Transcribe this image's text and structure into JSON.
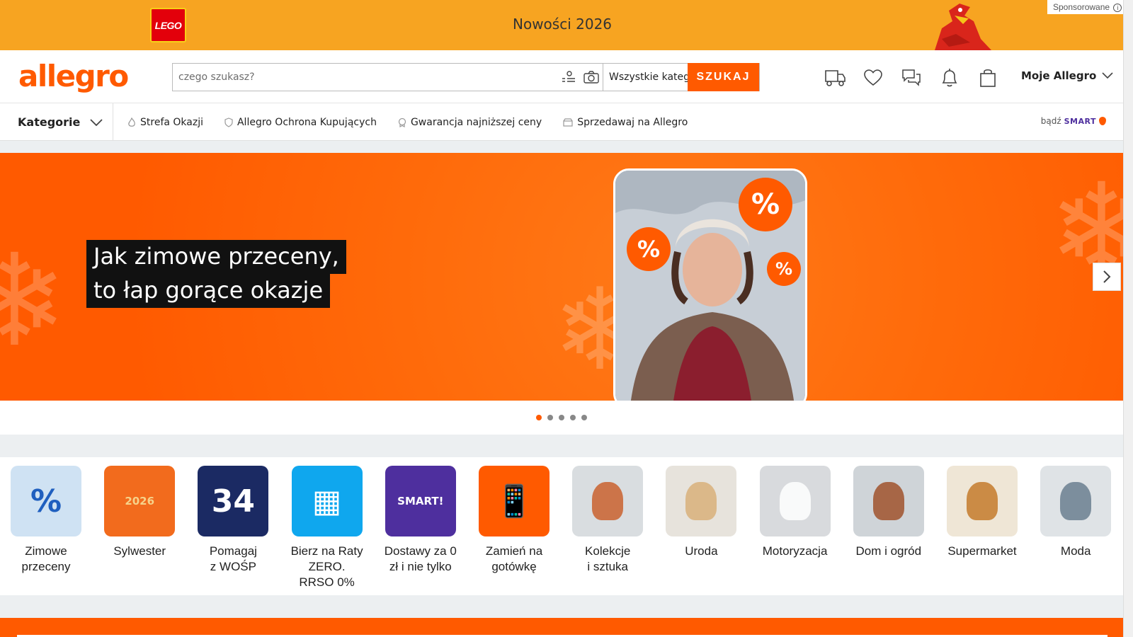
{
  "sponsor": {
    "brand": "LEGO",
    "title": "Nowości 2026",
    "tag": "Sponsorowane",
    "info_icon": "i"
  },
  "header": {
    "logo": "allegro",
    "search_placeholder": "czego szukasz?",
    "category_select": "Wszystkie kategorie",
    "search_button": "SZUKAJ",
    "my_allegro": "Moje Allegro",
    "icons": [
      "delivery-truck-icon",
      "heart-icon",
      "messages-icon",
      "bell-icon",
      "shopping-bag-icon"
    ]
  },
  "nav": {
    "kategorie": "Kategorie",
    "links": [
      {
        "label": "Strefa Okazji",
        "icon": "flame-icon"
      },
      {
        "label": "Allegro Ochrona Kupujących",
        "icon": "shield-icon"
      },
      {
        "label": "Gwarancja najniższej ceny",
        "icon": "badge-icon"
      },
      {
        "label": "Sprzedawaj na Allegro",
        "icon": "shop-icon"
      }
    ],
    "smart_prefix": "bądź",
    "smart_brand": "SMART"
  },
  "hero": {
    "line1": "Jak zimowe przeceny,",
    "line2": "to łap gorące okazje",
    "badge": "%",
    "slides_total": 5,
    "active_slide": 1
  },
  "categories": [
    {
      "label": "Zimowe\nprzeceny",
      "bg": "#cfe2f3",
      "glyph": "%",
      "color": "#1f5fbf"
    },
    {
      "label": "Sylwester",
      "bg": "#f26b1d",
      "glyph": "2026",
      "color": "#f6d28a"
    },
    {
      "label": "Pomagaj\nz WOŚP",
      "bg": "#1b2a63",
      "glyph": "34",
      "color": "#ffffff"
    },
    {
      "label": "Bierz na Raty\nZERO.\nRRSO 0%",
      "bg": "#0fa7ee",
      "glyph": "▦",
      "color": "#ffffff"
    },
    {
      "label": "Dostawy za 0\nzł i nie tylko",
      "bg": "#4e2f9e",
      "glyph": "SMART!",
      "color": "#ffffff"
    },
    {
      "label": "Zamień na\ngotówkę",
      "bg": "#ff5a00",
      "glyph": "📱",
      "color": "#ffffff"
    },
    {
      "label": "Kolekcje\ni sztuka",
      "bg": "#d9dde0",
      "glyph": "",
      "color": "#c9622e"
    },
    {
      "label": "Uroda",
      "bg": "#e7e3dc",
      "glyph": "",
      "color": "#d8b07a"
    },
    {
      "label": "Motoryzacja",
      "bg": "#d8dadd",
      "glyph": "",
      "color": "#ffffff"
    },
    {
      "label": "Dom i ogród",
      "bg": "#cfd4d8",
      "glyph": "",
      "color": "#a0522d"
    },
    {
      "label": "Supermarket",
      "bg": "#efe6d6",
      "glyph": "",
      "color": "#c47a2c"
    },
    {
      "label": "Moda",
      "bg": "#dfe3e6",
      "glyph": "",
      "color": "#6b7f8f"
    }
  ],
  "colors": {
    "brand": "#ff5a00",
    "banner": "#f7a421",
    "smart": "#4e2f9e"
  }
}
